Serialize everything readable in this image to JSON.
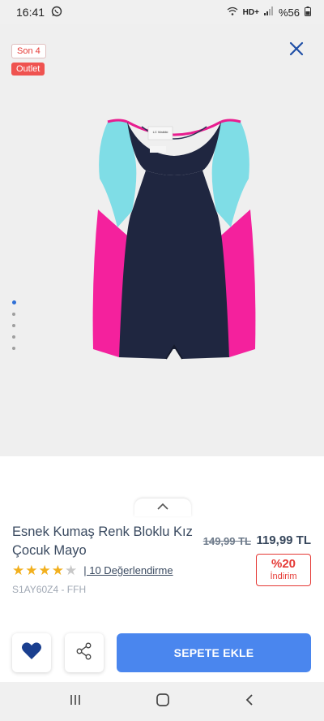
{
  "status_bar": {
    "time": "16:41",
    "network": "HD+",
    "battery": "%56"
  },
  "gallery": {
    "badge_stock": "Son 4",
    "badge_outlet": "Outlet",
    "image_count": 5,
    "active_index": 0
  },
  "product": {
    "title": "Esnek Kumaş Renk Bloklu Kız Çocuk Mayo",
    "old_price": "149,99 TL",
    "new_price": "119,99 TL",
    "discount_pct": "%20",
    "discount_label": "İndirim",
    "rating": 4,
    "rating_max": 5,
    "reviews": "| 10 Değerlendirme",
    "sku": "S1AY60Z4 - FFH",
    "label_text": "LC Waikiki"
  },
  "actions": {
    "add_to_cart": "SEPETE EKLE"
  },
  "colors": {
    "accent_blue": "#4a86ee",
    "favorite_blue": "#1a3f8f",
    "discount_red": "#e53935",
    "star_gold": "#f2b01e"
  }
}
